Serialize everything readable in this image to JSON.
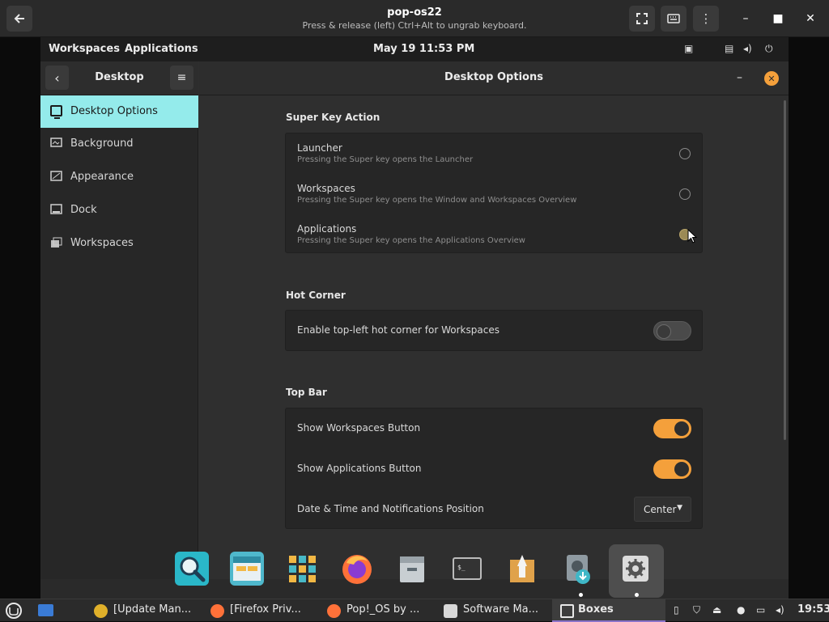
{
  "host": {
    "title": "pop-os22",
    "subtitle": "Press & release (left) Ctrl+Alt to ungrab keyboard."
  },
  "topbar": {
    "workspaces": "Workspaces",
    "applications": "Applications",
    "datetime": "May 19  11:53 PM"
  },
  "settings": {
    "sidebar_title": "Desktop",
    "main_title": "Desktop Options",
    "sidebar_items": [
      {
        "label": "Desktop Options",
        "icon": "monitor-icon",
        "active": true
      },
      {
        "label": "Background",
        "icon": "background-icon"
      },
      {
        "label": "Appearance",
        "icon": "appearance-icon"
      },
      {
        "label": "Dock",
        "icon": "dock-icon"
      },
      {
        "label": "Workspaces",
        "icon": "workspaces-icon"
      }
    ],
    "super_key": {
      "title": "Super Key Action",
      "options": [
        {
          "title": "Launcher",
          "subtitle": "Pressing the Super key opens the Launcher",
          "selected": false
        },
        {
          "title": "Workspaces",
          "subtitle": "Pressing the Super key opens the Window and Workspaces Overview",
          "selected": false
        },
        {
          "title": "Applications",
          "subtitle": "Pressing the Super key opens the Applications Overview",
          "selected": true
        }
      ]
    },
    "hot_corner": {
      "title": "Hot Corner",
      "label": "Enable top-left hot corner for Workspaces",
      "enabled": false
    },
    "top_bar": {
      "title": "Top Bar",
      "show_workspaces": "Show Workspaces Button",
      "show_workspaces_on": true,
      "show_applications": "Show Applications Button",
      "show_applications_on": true,
      "datetime_position_label": "Date & Time and Notifications Position",
      "datetime_position_value": "Center"
    }
  },
  "dock": {
    "apps": [
      "search-icon",
      "files-icon",
      "app-grid-icon",
      "firefox-icon",
      "file-manager-icon",
      "terminal-icon",
      "pop-shop-icon",
      "installer-icon",
      "settings-icon"
    ]
  },
  "taskbar": {
    "tasks": [
      "[Update Man...",
      "[Firefox Priv...",
      "Pop!_OS by ...",
      "Software Ma...",
      "Boxes"
    ],
    "clock": "19:53"
  },
  "colors": {
    "accent": "#f4a03b",
    "sidebar_active": "#94ebeb",
    "taskbar_active": "#8b73c9"
  }
}
